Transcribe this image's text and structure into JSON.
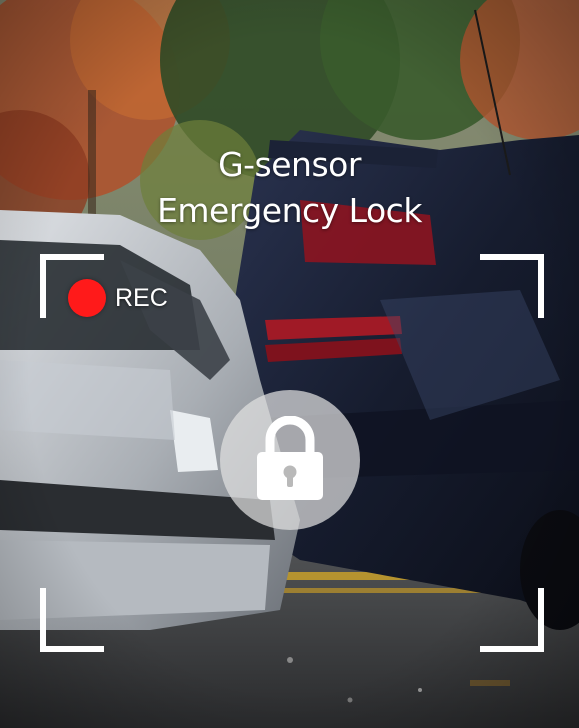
{
  "headline": {
    "line1": "G-sensor",
    "line2": "Emergency Lock"
  },
  "recording": {
    "label": "REC",
    "dot_color": "#ff1a1a"
  },
  "icons": {
    "center": "lock-icon",
    "indicator": "record-dot-icon",
    "frame": "viewfinder-corners"
  },
  "colors": {
    "text": "#ffffff",
    "lock_badge": "#e1e1e1",
    "lock_glyph": "#ffffff"
  }
}
